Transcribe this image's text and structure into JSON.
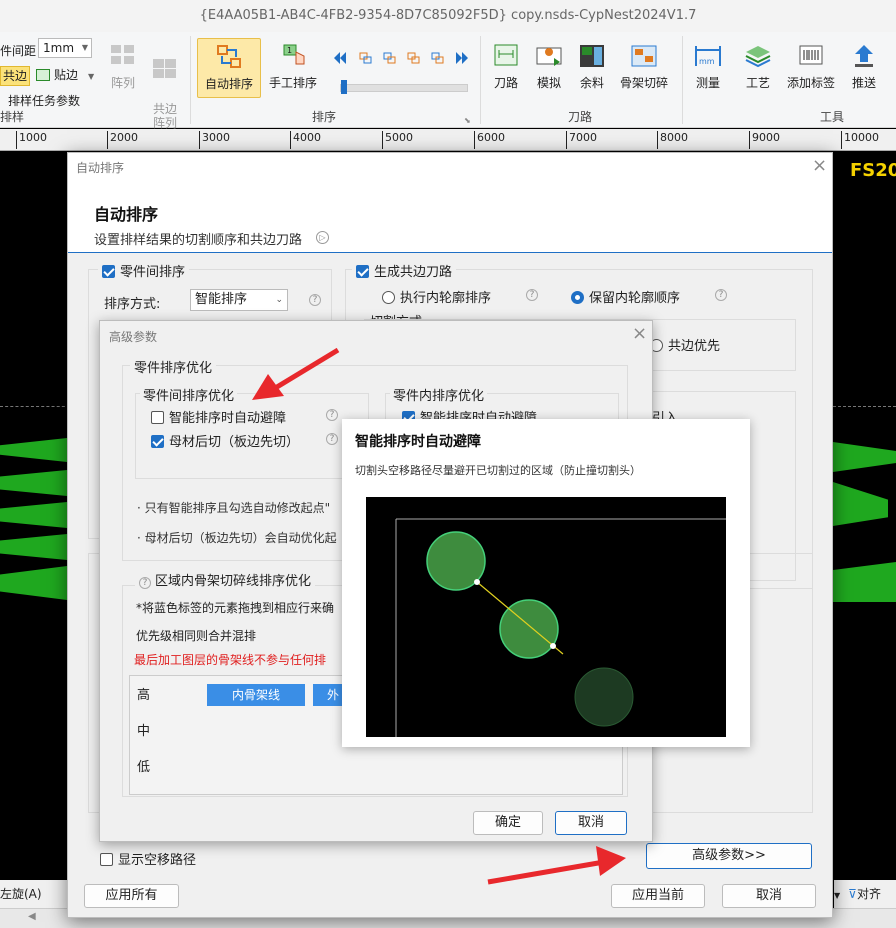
{
  "window": {
    "title": "{E4AA05B1-AB4C-4FB2-9354-8D7C85092F5D} copy.nsds-CypNest2024V1.7"
  },
  "ribbon": {
    "spacing_label": "件间距",
    "spacing_value": "1mm",
    "common_edge": "共边",
    "paste_edge": "贴边",
    "task_params": "排样任务参数",
    "array_label": "阵列",
    "common_array_label": "共边\n阵列",
    "group_nest": "排样",
    "auto_sort": "自动排序",
    "manual_sort": "手工排序",
    "group_sort": "排序",
    "toolpath": "刀路",
    "simulate": "模拟",
    "remnant": "余料",
    "skeleton_cut": "骨架切碎",
    "group_toolpath": "刀路",
    "measure": "测量",
    "process": "工艺",
    "add_tag": "添加标签",
    "push": "推送",
    "group_tools": "工具"
  },
  "ruler": {
    "ticks": [
      "1000",
      "2000",
      "3000",
      "4000",
      "5000",
      "6000",
      "7000",
      "8000",
      "9000",
      "10000"
    ]
  },
  "canvas": {
    "fs_label": "FS20"
  },
  "statusbar": {
    "rotate_left": "左旋(A)",
    "align": "对齐"
  },
  "dialog": {
    "title": "自动排序",
    "heading": "自动排序",
    "subtitle": "设置排样结果的切割顺序和共边刀路",
    "part_sort": {
      "label": "零件间排序",
      "method_label": "排序方式:",
      "method_value": "智能排序"
    },
    "common_edge": {
      "label": "生成共边刀路",
      "inner_sort": "执行内轮廓排序",
      "keep_inner": "保留内轮廓顺序",
      "cut_mode": "切割方式",
      "common_first": "共边优先",
      "partial": "引入"
    },
    "show_travel": "显示空移路径",
    "advanced_btn": "高级参数>>",
    "apply_all": "应用所有",
    "apply_current": "应用当前",
    "cancel": "取消"
  },
  "advanced": {
    "title": "高级参数",
    "group_title": "零件排序优化",
    "between_title": "零件间排序优化",
    "auto_avoid": "智能排序时自动避障",
    "sheet_last": "母材后切（板边先切）",
    "inner_title": "零件内排序优化",
    "inner_auto_avoid": "智能排序时自动避障",
    "note1": "· 只有智能排序且勾选自动修改起点\"",
    "note2": "· 母材后切（板边先切）会自动优化起",
    "region_title": "区域内骨架切碎线排序优化",
    "drag_hint": "*将蓝色标签的元素拖拽到相应行来确",
    "same_priority": "优先级相同则合并混排",
    "warning": "最后加工图层的骨架线不参与任何排",
    "priorities": [
      "高",
      "中",
      "低"
    ],
    "tags": [
      "内骨架线",
      "外"
    ],
    "ok": "确定",
    "cancel": "取消"
  },
  "tooltip": {
    "title": "智能排序时自动避障",
    "desc": "切割头空移路径尽量避开已切割过的区域（防止撞切割头）"
  },
  "colors": {
    "accent": "#1f6fc5",
    "tag_blue": "#3a8ee6",
    "warning_red": "#e02020",
    "part_green": "#1fa81f",
    "arrow_red": "#e8282c"
  }
}
